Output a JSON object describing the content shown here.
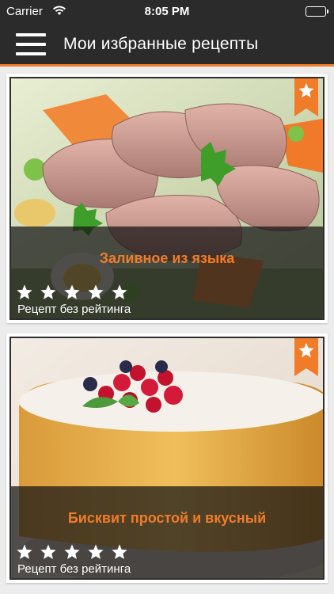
{
  "status_bar": {
    "carrier": "Carrier",
    "time": "8:05 PM"
  },
  "nav": {
    "title": "Мои избранные рецепты"
  },
  "recipes": [
    {
      "title": "Заливное из языка",
      "stars": 5,
      "rating_text": "Рецепт без рейтинга",
      "favorite": true
    },
    {
      "title": "Бисквит простой и вкусный",
      "stars": 5,
      "rating_text": "Рецепт без рейтинга",
      "favorite": true
    }
  ],
  "colors": {
    "accent": "#f07c2a",
    "bar": "#2b2b2b"
  }
}
